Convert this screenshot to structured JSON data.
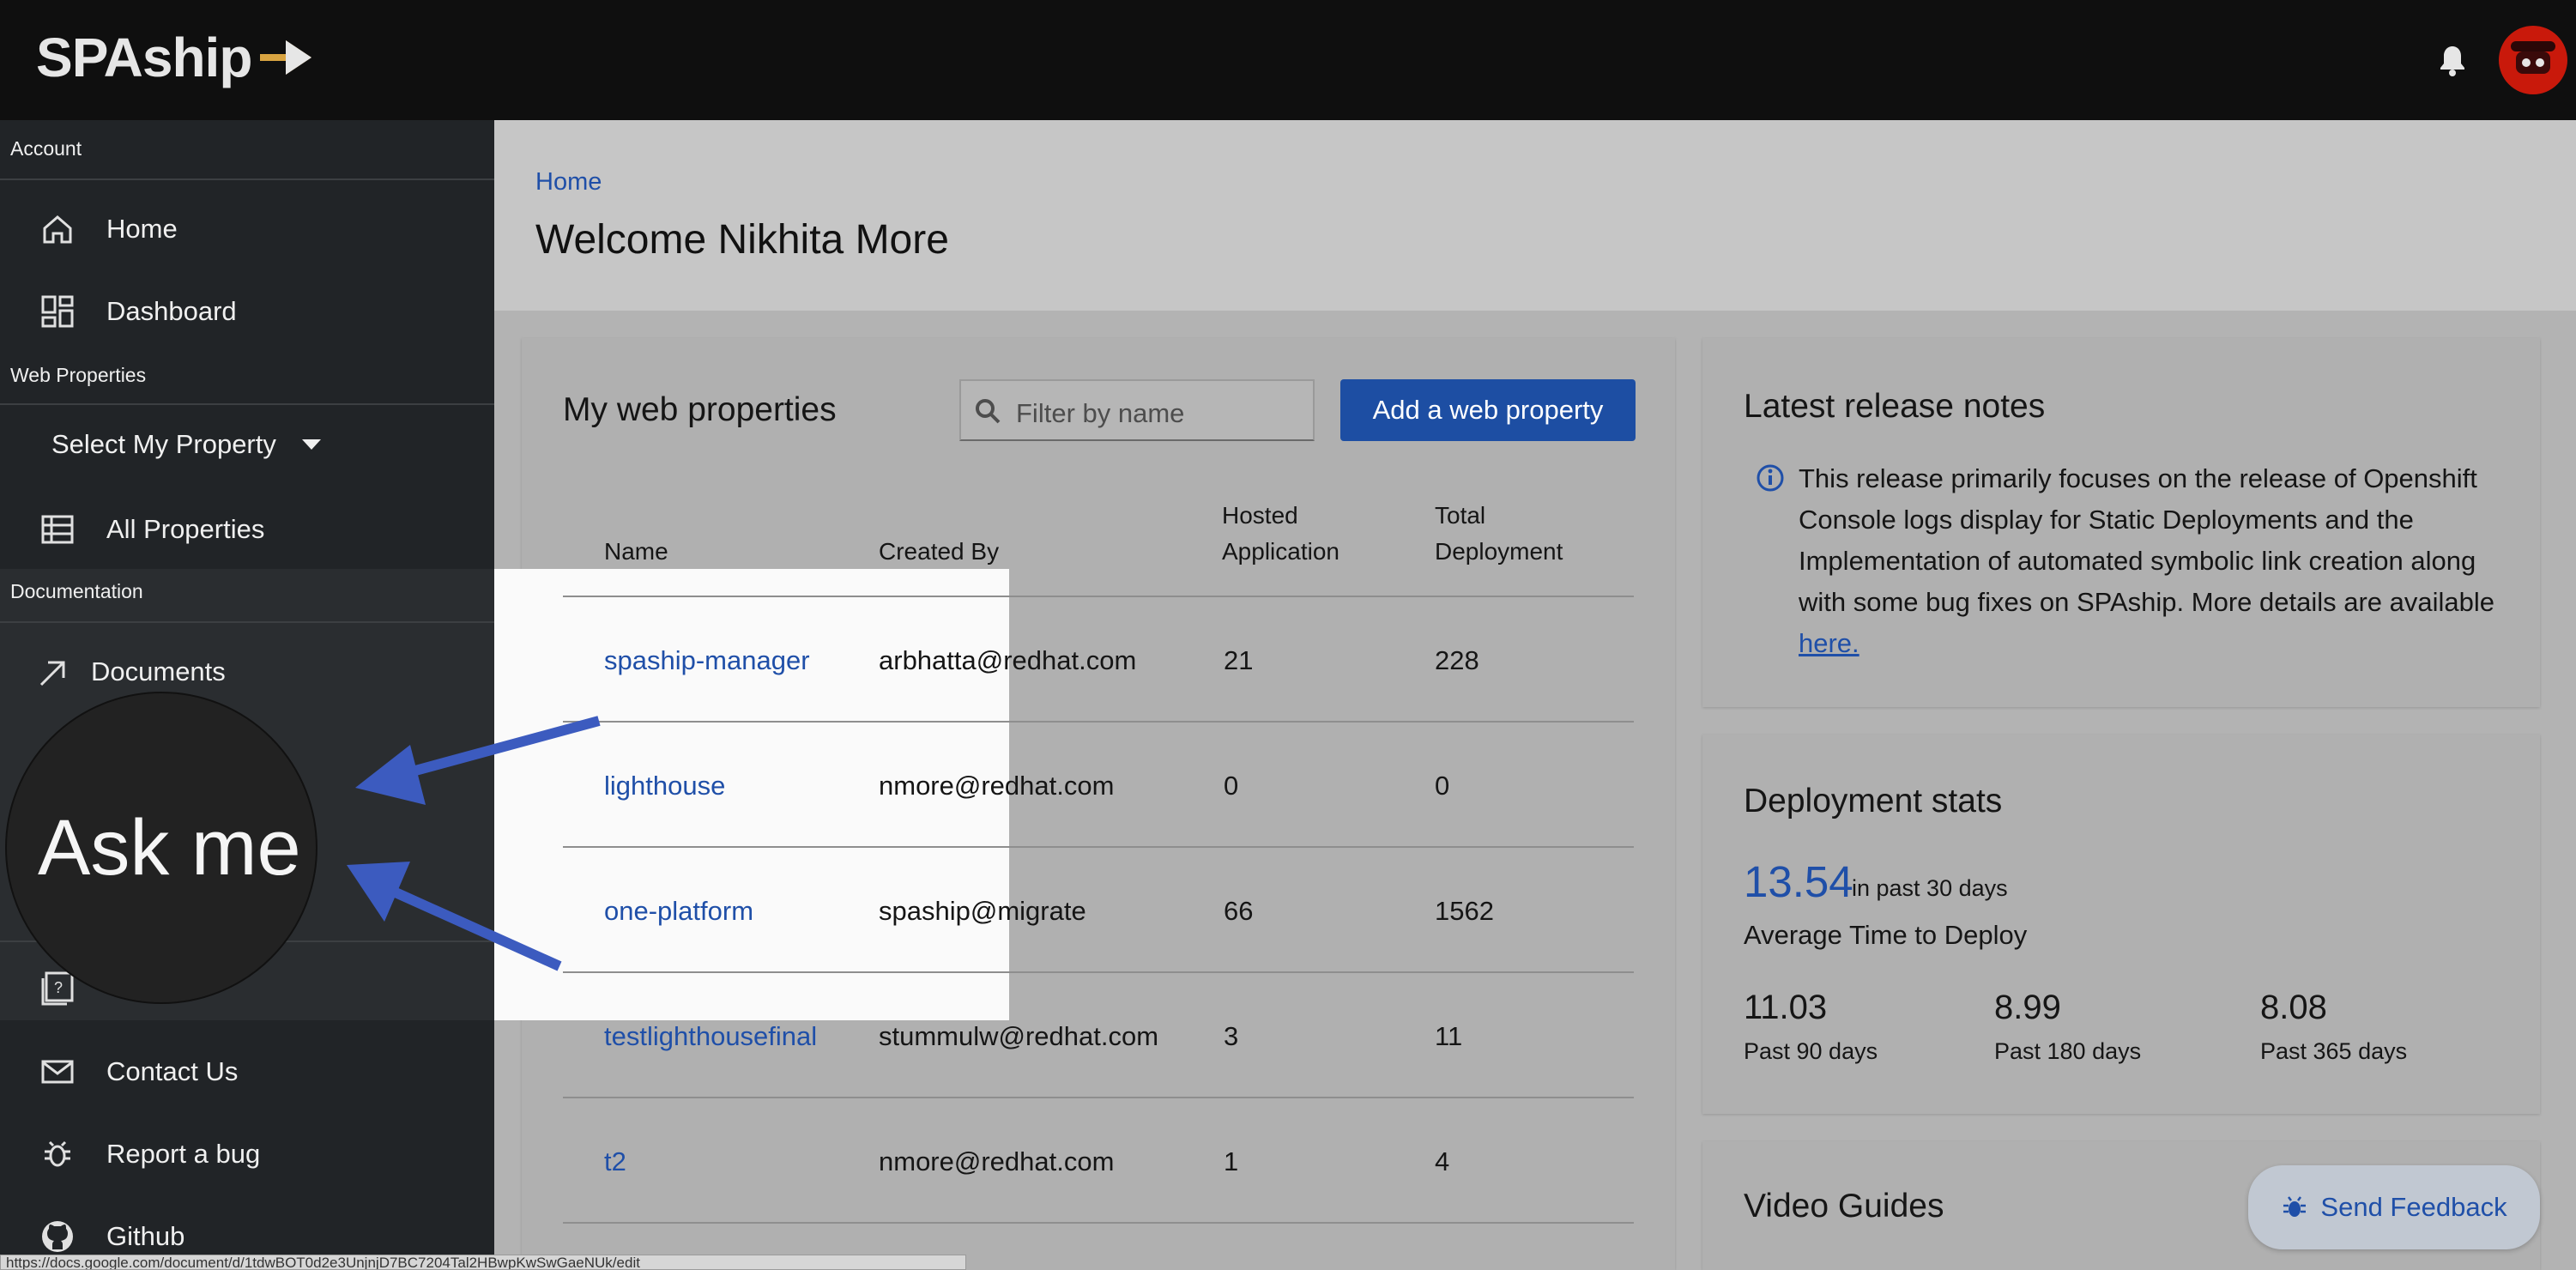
{
  "app": {
    "logo_text": "SPAship"
  },
  "sidebar": {
    "account_section": "Account",
    "home": "Home",
    "dashboard": "Dashboard",
    "web_properties_section": "Web Properties",
    "select_property": "Select My Property",
    "all_properties": "All Properties",
    "documentation_section": "Documentation",
    "documents": "Documents",
    "contact_us": "Contact Us",
    "report_bug": "Report a bug",
    "github": "Github"
  },
  "main": {
    "breadcrumb": "Home",
    "welcome": "Welcome Nikhita More"
  },
  "properties": {
    "title": "My web properties",
    "filter_placeholder": "Filter by name",
    "add_button": "Add a web property",
    "headers": {
      "name": "Name",
      "created_by": "Created By",
      "hosted_1": "Hosted",
      "hosted_2": "Application",
      "total_1": "Total",
      "total_2": "Deployment"
    },
    "rows": [
      {
        "name": "spaship-manager",
        "created_by": "arbhatta@redhat.com",
        "hosted": "21",
        "total": "228"
      },
      {
        "name": "lighthouse",
        "created_by": "nmore@redhat.com",
        "hosted": "0",
        "total": "0"
      },
      {
        "name": "one-platform",
        "created_by": "spaship@migrate",
        "hosted": "66",
        "total": "1562"
      },
      {
        "name": "testlighthousefinal",
        "created_by": "stummulw@redhat.com",
        "hosted": "3",
        "total": "11"
      },
      {
        "name": "t2",
        "created_by": "nmore@redhat.com",
        "hosted": "1",
        "total": "4"
      }
    ]
  },
  "release_notes": {
    "title": "Latest release notes",
    "text": "This release primarily focuses on the release of Openshift Console logs display for Static Deployments and the Implementation of automated symbolic link creation along with some bug fixes on SPAship. More details are available ",
    "link": "here."
  },
  "stats": {
    "title": "Deployment stats",
    "big_value": "13.54",
    "big_sub": "in past 30 days",
    "avg_label": "Average Time to Deploy",
    "items": [
      {
        "value": "11.03",
        "label": "Past 90 days"
      },
      {
        "value": "8.99",
        "label": "Past 180 days"
      },
      {
        "value": "8.08",
        "label": "Past 365 days"
      }
    ]
  },
  "video": {
    "title": "Video Guides"
  },
  "feedback": {
    "label": "Send Feedback"
  },
  "status_url": "https://docs.google.com/document/d/1tdwBOT0d2e3UnjnjD7BC7204Tal2HBwpKwSwGaeNUk/edit",
  "overlay": {
    "zoom_text": "Ask me"
  },
  "colors": {
    "accent": "#1d4ea3",
    "link": "#1f4fa8",
    "topbar": "#0f0f0f",
    "sidebar": "#212427"
  }
}
